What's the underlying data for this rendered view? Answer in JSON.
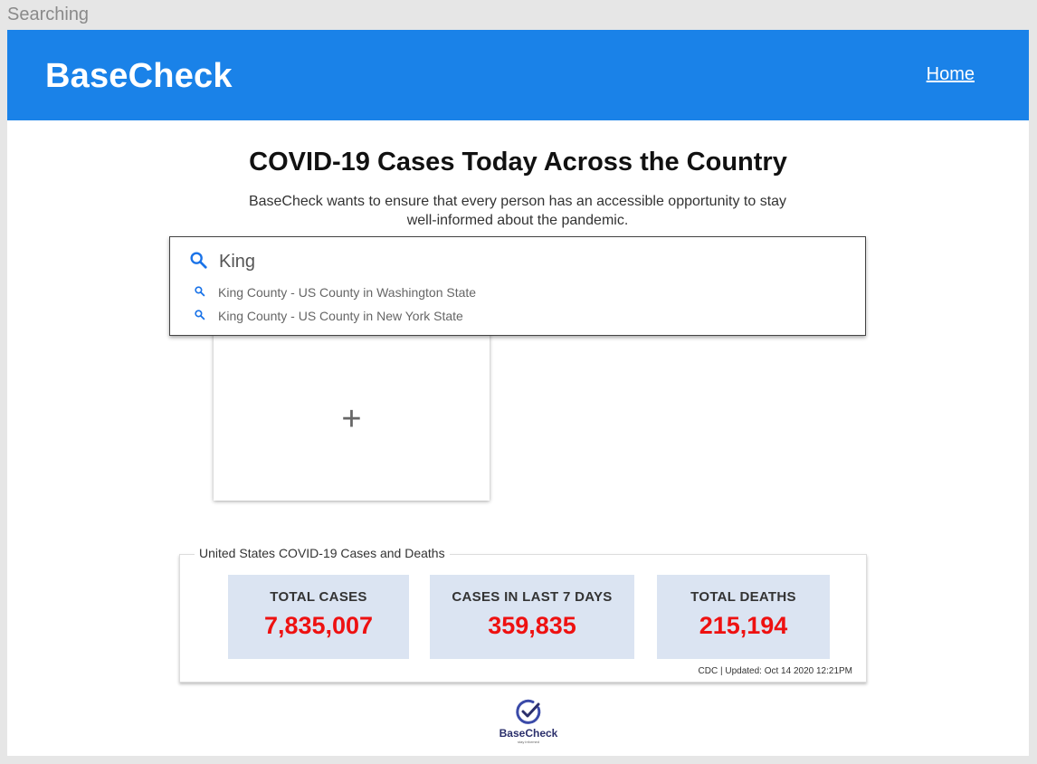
{
  "frame": {
    "label": "Searching"
  },
  "header": {
    "brand": "BaseCheck",
    "home_link": "Home"
  },
  "main": {
    "title": "COVID-19 Cases Today Across the Country",
    "subtitle": "BaseCheck wants to ensure that every person has an accessible opportunity to stay well-informed about the pandemic."
  },
  "search": {
    "value": "King",
    "icon": "search-icon",
    "suggestions": [
      {
        "label": "King County - US County in Washington State"
      },
      {
        "label": "King County - US County in New York State"
      }
    ]
  },
  "add_card": {
    "icon": "plus-icon",
    "symbol": "+"
  },
  "stats": {
    "legend": "United States COVID-19 Cases and Deaths",
    "items": [
      {
        "label": "TOTAL CASES",
        "value": "7,835,007"
      },
      {
        "label": "CASES IN LAST 7 DAYS",
        "value": "359,835"
      },
      {
        "label": "TOTAL DEATHS",
        "value": "215,194"
      }
    ],
    "source": "CDC | Updated: Oct 14 2020 12:21PM"
  },
  "footer": {
    "brand": "BaseCheck",
    "tagline": "stay informed"
  },
  "colors": {
    "header_bg": "#1a82e8",
    "stat_bg": "#dbe4f2",
    "stat_value": "#ee1111",
    "search_icon": "#1a73e8",
    "logo": "#2b2f6b"
  }
}
